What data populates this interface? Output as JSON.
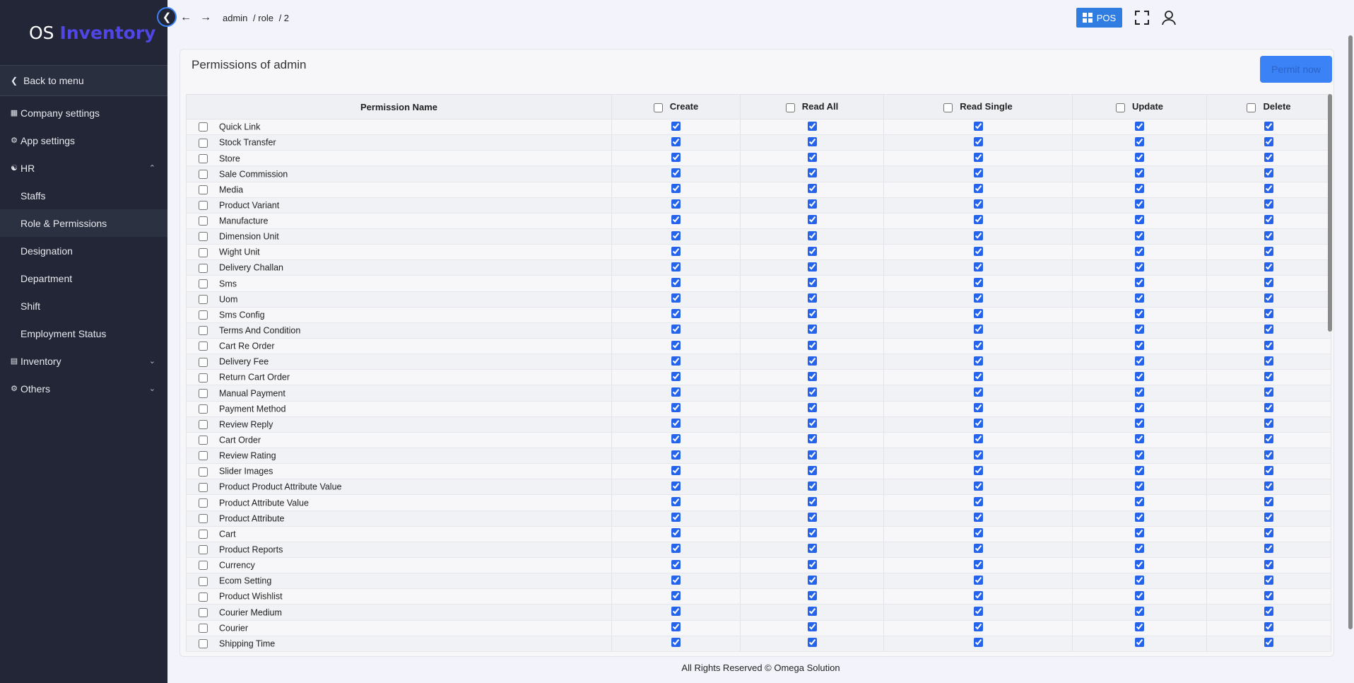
{
  "sidebar": {
    "brand_part1": "OS",
    "brand_part2": "Inventory",
    "back": "Back to menu",
    "items": [
      {
        "label": "Company settings"
      },
      {
        "label": "App settings"
      },
      {
        "label": "HR"
      }
    ],
    "hr_sub": [
      {
        "label": "Staffs"
      },
      {
        "label": "Role & Permissions"
      },
      {
        "label": "Designation"
      },
      {
        "label": "Department"
      },
      {
        "label": "Shift"
      },
      {
        "label": "Employment Status"
      }
    ],
    "bottom": [
      {
        "label": "Inventory"
      },
      {
        "label": "Others"
      }
    ],
    "active": "Role & Permissions"
  },
  "header": {
    "breadcrumb": [
      "admin",
      "/ role",
      "/ 2"
    ],
    "pos_label": "POS"
  },
  "page": {
    "title": "Permissions of admin",
    "permit_button": "Permit now"
  },
  "table": {
    "columns": [
      "Permission Name",
      "Create",
      "Read All",
      "Read Single",
      "Update",
      "Delete"
    ],
    "rows": [
      "Quick Link",
      "Stock Transfer",
      "Store",
      "Sale Commission",
      "Media",
      "Product Variant",
      "Manufacture",
      "Dimension Unit",
      "Wight Unit",
      "Delivery Challan",
      "Sms",
      "Uom",
      "Sms Config",
      "Terms And Condition",
      "Cart Re Order",
      "Delivery Fee",
      "Return Cart Order",
      "Manual Payment",
      "Payment Method",
      "Review Reply",
      "Cart Order",
      "Review Rating",
      "Slider Images",
      "Product Product Attribute Value",
      "Product Attribute Value",
      "Product Attribute",
      "Cart",
      "Product Reports",
      "Currency",
      "Ecom Setting",
      "Product Wishlist",
      "Courier Medium",
      "Courier",
      "Shipping Time"
    ],
    "row_selected": false,
    "permissions_checked": true,
    "header_checked": false
  },
  "footer": "All Rights Reserved © Omega Solution",
  "colors": {
    "sidebar_bg": "#222636",
    "brand_accent": "#4f46e5",
    "primary": "#3b82f6"
  }
}
